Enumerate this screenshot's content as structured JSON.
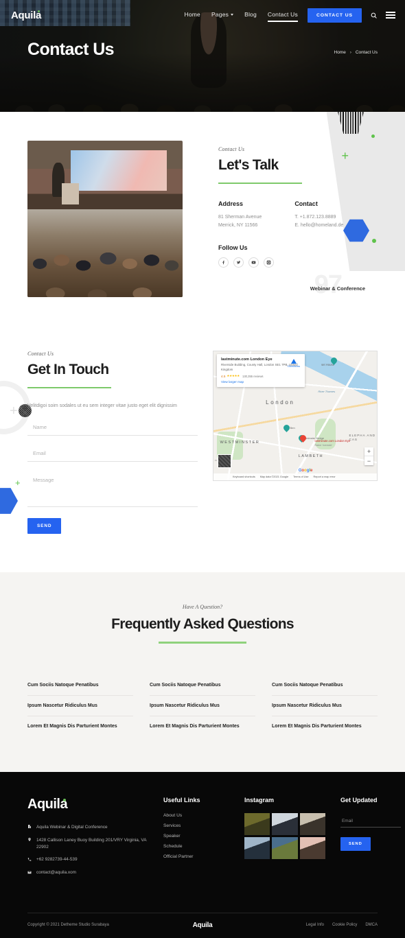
{
  "nav": {
    "brand": "Aquila",
    "links": [
      {
        "label": "Home",
        "active": false,
        "caret": false
      },
      {
        "label": "Pages",
        "active": false,
        "caret": true
      },
      {
        "label": "Blog",
        "active": false,
        "caret": false
      },
      {
        "label": "Contact Us",
        "active": true,
        "caret": false
      }
    ],
    "cta": "CONTACT US",
    "search_icon": "search-icon",
    "menu_icon": "hamburger-icon"
  },
  "hero": {
    "title": "Contact Us",
    "breadcrumb": {
      "home": "Home",
      "sep": "›",
      "current": "Contact Us"
    }
  },
  "talk": {
    "eyebrow": "Contact Us",
    "heading": "Let's Talk",
    "address_title": "Address",
    "address_line1": "81 Sherman Avenue",
    "address_line2": "Merrick, NY 11566",
    "contact_title": "Contact",
    "contact_line1": "T. +1.872.123.8889",
    "contact_line2": "E. hello@homeland.de",
    "follow_title": "Follow Us",
    "socials": [
      "facebook-icon",
      "twitter-icon",
      "youtube-icon",
      "instagram-icon"
    ],
    "ghost_number": "97",
    "ghost_label": "Webinar & Conference"
  },
  "touch": {
    "eyebrow": "Contact Us",
    "heading": "Get In Touch",
    "lead": "Velitdigoi soim sodales ut eu sem integer vitae justo eget elit dignissim",
    "name_placeholder": "Name",
    "email_placeholder": "Email",
    "message_placeholder": "Message",
    "send_label": "SEND"
  },
  "map": {
    "card_title": "lastminute.com London Eye",
    "card_address": "Riverside Building, County Hall, London SE1 7PB, United Kingdom",
    "rating": "4.5",
    "stars": "★★★★★",
    "reviews": "130,355 reviews",
    "view_larger": "View larger map",
    "directions": "Directions",
    "pin_title": "lastminute.com London Eye",
    "pin_sub": "Rated 'riverside'",
    "labels": {
      "london": "London",
      "westminster": "WESTMINSTER",
      "lambeth": "LAMBETH",
      "elephant": "ELEPHA AND CAS",
      "thames": "River Thames",
      "bigben": "Big Ben",
      "westminster_bridge": "Westminster Bridge",
      "set_house": "set House",
      "park": "n Park"
    },
    "zoom_in": "+",
    "zoom_out": "−",
    "footer": [
      "Keyboard shortcuts",
      "Map data ©2021 Google",
      "Terms of Use",
      "Report a map error"
    ],
    "logo_letters": [
      "G",
      "o",
      "o",
      "g",
      "l",
      "e"
    ]
  },
  "faq": {
    "eyebrow": "Have A Question?",
    "title": "Frequently Asked Questions",
    "columns": [
      [
        "Cum Sociis Natoque Penatibus",
        "Ipsum Nascetur Ridiculus Mus",
        "Lorem Et Magnis Dis Parturient Montes"
      ],
      [
        "Cum Sociis Natoque Penatibus",
        "Ipsum Nascetur Ridiculus Mus",
        "Lorem Et Magnis Dis Parturient Montes"
      ],
      [
        "Cum Sociis Natoque Penatibus",
        "Ipsum Nascetur Ridiculus Mus",
        "Lorem Et Magnis Dis Parturient Montes"
      ]
    ]
  },
  "footer": {
    "brand": "Aquila",
    "contact": [
      {
        "icon": "building-icon",
        "text": "Aquila Webinar & Digital Conference"
      },
      {
        "icon": "location-icon",
        "text": "1428 Callison Laney Buoy Building 201/VRY Virginia, VA 22902"
      },
      {
        "icon": "phone-icon",
        "text": "+62 9282739-44-539"
      },
      {
        "icon": "mail-icon",
        "text": "contact@aquila.xom"
      }
    ],
    "links_title": "Useful Links",
    "links": [
      "About Us",
      "Services",
      "Speaker",
      "Schedule",
      "Official Partner"
    ],
    "instagram_title": "Instagram",
    "instagram_count": 6,
    "updated_title": "Get Updated",
    "email_placeholder": "Email",
    "send_label": "SEND",
    "copyright": "Copyright © 2021 Detheme Studio Surabaya",
    "bottom_logo": "Aquila",
    "bottom_links": [
      "Legal Info",
      "Cookie Policy",
      "DMCA"
    ]
  },
  "colors": {
    "accent_blue": "#2563f0",
    "accent_green": "#7dc96a",
    "dark": "#080808",
    "faq_bg": "#f5f4f2"
  }
}
